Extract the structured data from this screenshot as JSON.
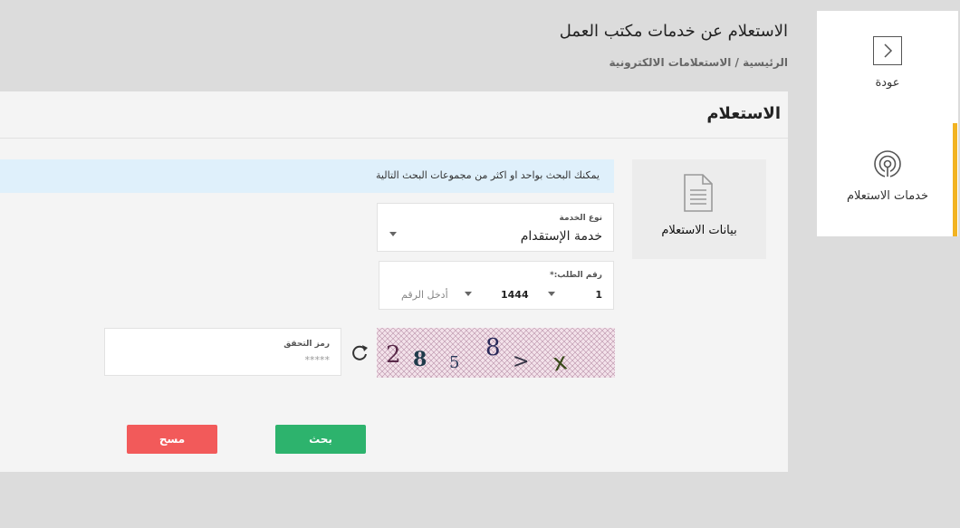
{
  "header": {
    "title": "الاستعلام عن خدمات مكتب العمل",
    "breadcrumb": "الرئيسية / الاستعلامات الالكترونية"
  },
  "sidenav": {
    "back_label": "عودة",
    "services_label": "خدمات الاستعلام"
  },
  "panel": {
    "title": "الاستعلام",
    "tab_label": "بيانات الاستعلام",
    "info_text": "يمكنك البحث بواحد او اكثر من مجموعات البحث التالية",
    "service_type": {
      "label": "نوع الخدمة",
      "value": "خدمة الإستقدام"
    },
    "request_number": {
      "label": "رقم الطلب:*",
      "part1": "1",
      "part2": "1444",
      "part3_placeholder": "أدخل الرقم"
    },
    "captcha_text": "285 8>x",
    "verification_code": {
      "label": "رمز التحقق",
      "placeholder": "*****"
    },
    "search_button": "بحث",
    "clear_button": "مسح"
  },
  "colors": {
    "accent": "#f2b322",
    "search_button": "#2db36d",
    "clear_button": "#f25a5a",
    "info_bg": "#dff0fb"
  },
  "icons": {
    "back": "chevron-right-icon",
    "services": "broadcast-icon",
    "tab": "document-icon",
    "refresh": "refresh-icon"
  }
}
